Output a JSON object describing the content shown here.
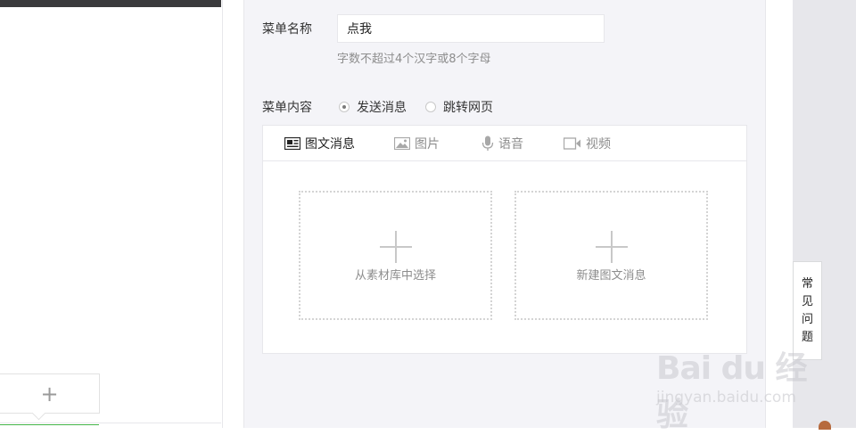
{
  "editor": {
    "name_label": "菜单名称",
    "name_value": "点我",
    "name_hint": "字数不超过4个汉字或8个字母",
    "content_label": "菜单内容",
    "radio_options": [
      {
        "label": "发送消息",
        "selected": true
      },
      {
        "label": "跳转网页",
        "selected": false
      }
    ],
    "tabs": [
      {
        "label": "图文消息",
        "icon": "news-icon",
        "active": true
      },
      {
        "label": "图片",
        "icon": "image-icon",
        "active": false
      },
      {
        "label": "语音",
        "icon": "microphone-icon",
        "active": false
      },
      {
        "label": "视频",
        "icon": "video-icon",
        "active": false
      }
    ],
    "choose_from_library": "从素材库中选择",
    "create_news": "新建图文消息"
  },
  "sidebar_right": {
    "faq_chars": [
      "常",
      "见",
      "问",
      "题"
    ]
  },
  "left_preview": {
    "add_symbol": "+"
  },
  "watermark": {
    "logo": "Bai du 经验",
    "url": "jingyan.baidu.com"
  },
  "colors": {
    "accent_green": "#44b549",
    "editor_bg": "#f4f4f8",
    "border": "#e7e7eb"
  }
}
